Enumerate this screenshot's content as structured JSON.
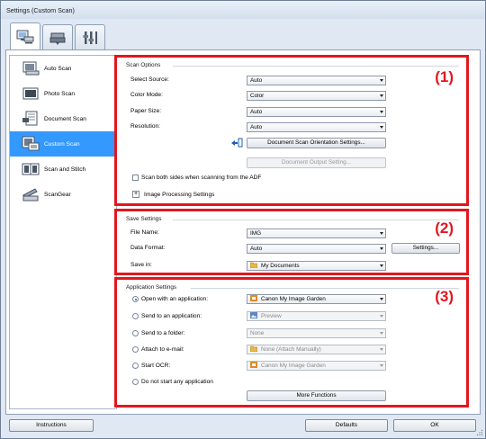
{
  "window": {
    "title": "Settings (Custom Scan)"
  },
  "top_tabs": [
    {
      "icon": "scanner-computer-icon",
      "active": true
    },
    {
      "icon": "scanner-icon",
      "active": false
    },
    {
      "icon": "tools-icon",
      "active": false
    }
  ],
  "sidebar": {
    "items": [
      {
        "label": "Auto Scan",
        "icon": "auto-scan-icon"
      },
      {
        "label": "Photo Scan",
        "icon": "photo-scan-icon"
      },
      {
        "label": "Document Scan",
        "icon": "document-scan-icon"
      },
      {
        "label": "Custom Scan",
        "icon": "custom-scan-icon",
        "active": true
      },
      {
        "label": "Scan and Stitch",
        "icon": "scan-and-stitch-icon"
      },
      {
        "label": "ScanGear",
        "icon": "scangear-icon"
      }
    ]
  },
  "scan_options": {
    "title": "Scan Options",
    "marker": "(1)",
    "select_source": {
      "label": "Select Source:",
      "value": "Auto"
    },
    "color_mode": {
      "label": "Color Mode:",
      "value": "Color"
    },
    "paper_size": {
      "label": "Paper Size:",
      "value": "Auto"
    },
    "resolution": {
      "label": "Resolution:",
      "value": "Auto"
    },
    "orientation_button": "Document Scan Orientation Settings...",
    "output_button": "Document Output Setting...",
    "scan_both_sides": "Scan both sides when scanning from the ADF",
    "image_processing": "Image Processing Settings",
    "expander_symbol": "+"
  },
  "save_settings": {
    "title": "Save Settings",
    "marker": "(2)",
    "file_name": {
      "label": "File Name:",
      "value": "IMG"
    },
    "data_format": {
      "label": "Data Format:",
      "value": "Auto"
    },
    "settings_button": "Settings...",
    "save_in": {
      "label": "Save in:",
      "value": "My Documents"
    }
  },
  "application_settings": {
    "title": "Application Settings",
    "marker": "(3)",
    "options": [
      {
        "label": "Open with an application:",
        "value": "Canon My Image Garden",
        "checked": true,
        "enabled": true,
        "icon": "canon-app-icon"
      },
      {
        "label": "Send to an application:",
        "value": "Preview",
        "checked": false,
        "enabled": false,
        "icon": "preview-app-icon"
      },
      {
        "label": "Send to a folder:",
        "value": "None",
        "checked": false,
        "enabled": false,
        "icon": ""
      },
      {
        "label": "Attach to e-mail:",
        "value": "None (Attach Manually)",
        "checked": false,
        "enabled": false,
        "icon": "mail-folder-icon"
      },
      {
        "label": "Start OCR:",
        "value": "Canon My Image Garden",
        "checked": false,
        "enabled": false,
        "icon": "canon-app-icon"
      },
      {
        "label": "Do not start any application",
        "checked": false
      }
    ],
    "more_functions": "More Functions"
  },
  "footer": {
    "instructions": "Instructions",
    "defaults": "Defaults",
    "ok": "OK"
  },
  "colors": {
    "highlight_red": "#e3161e",
    "selection_blue": "#3399ff",
    "window_frame": "#dfe8f3"
  }
}
